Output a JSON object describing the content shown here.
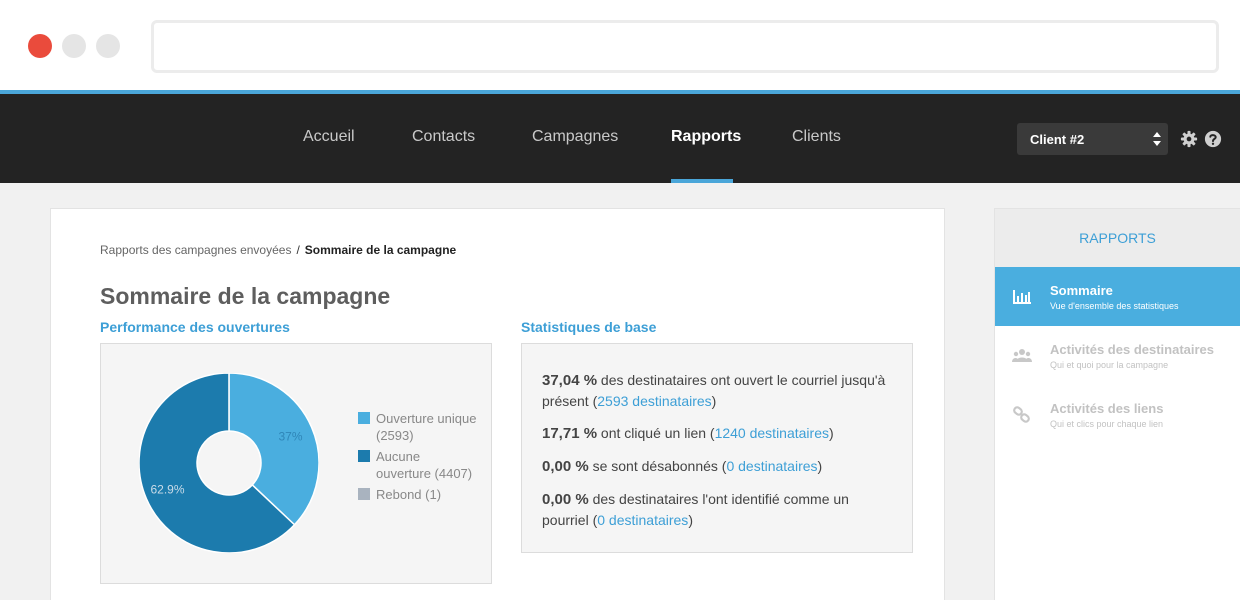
{
  "nav": {
    "items": [
      {
        "label": "Accueil",
        "active": false
      },
      {
        "label": "Contacts",
        "active": false
      },
      {
        "label": "Campagnes",
        "active": false
      },
      {
        "label": "Rapports",
        "active": true
      },
      {
        "label": "Clients",
        "active": false
      }
    ],
    "client_select": "Client #2",
    "icons": [
      "gear-icon",
      "help-icon"
    ]
  },
  "breadcrumb": {
    "parent": "Rapports des campagnes envoyées",
    "separator": "/",
    "current": "Sommaire de la campagne"
  },
  "main": {
    "title": "Sommaire de la campagne",
    "performance_title": "Performance des ouvertures",
    "stats_title": "Statistiques de base"
  },
  "chart_data": {
    "type": "pie",
    "donut": true,
    "categories": [
      "Ouverture unique (2593)",
      "Aucune ouverture (4407)",
      "Rebond (1)"
    ],
    "values": [
      37.0,
      62.9,
      0.01
    ],
    "data_labels": [
      "37%",
      "62.9%",
      ""
    ],
    "colors": [
      "#4aaedf",
      "#1c7bad",
      "#a9b3bf"
    ],
    "legend_position": "right"
  },
  "stats": [
    {
      "pct": "37,04 %",
      "text": " des destinataires ont ouvert le courriel jusqu'à présent (",
      "link": "2593 destinataires",
      "end": ")"
    },
    {
      "pct": "17,71 %",
      "text": " ont cliqué un lien (",
      "link": "1240 destinataires",
      "end": ")"
    },
    {
      "pct": "0,00 %",
      "text": " se sont désabonnés (",
      "link": "0 destinataires",
      "end": ")"
    },
    {
      "pct": "0,00 %",
      "text": " des destinataires l'ont identifié comme un pourriel (",
      "link": "0 destinataires",
      "end": ")"
    }
  ],
  "sidebar": {
    "header": "RAPPORTS",
    "items": [
      {
        "label": "Sommaire",
        "sub": "Vue d'ensemble des statistiques",
        "icon": "bar-chart-icon",
        "active": true
      },
      {
        "label": "Activités des destinataires",
        "sub": "Qui et quoi pour la campagne",
        "icon": "users-icon",
        "active": false
      },
      {
        "label": "Activités des liens",
        "sub": "Qui et clics pour chaque lien",
        "icon": "link-icon",
        "active": false
      }
    ]
  }
}
